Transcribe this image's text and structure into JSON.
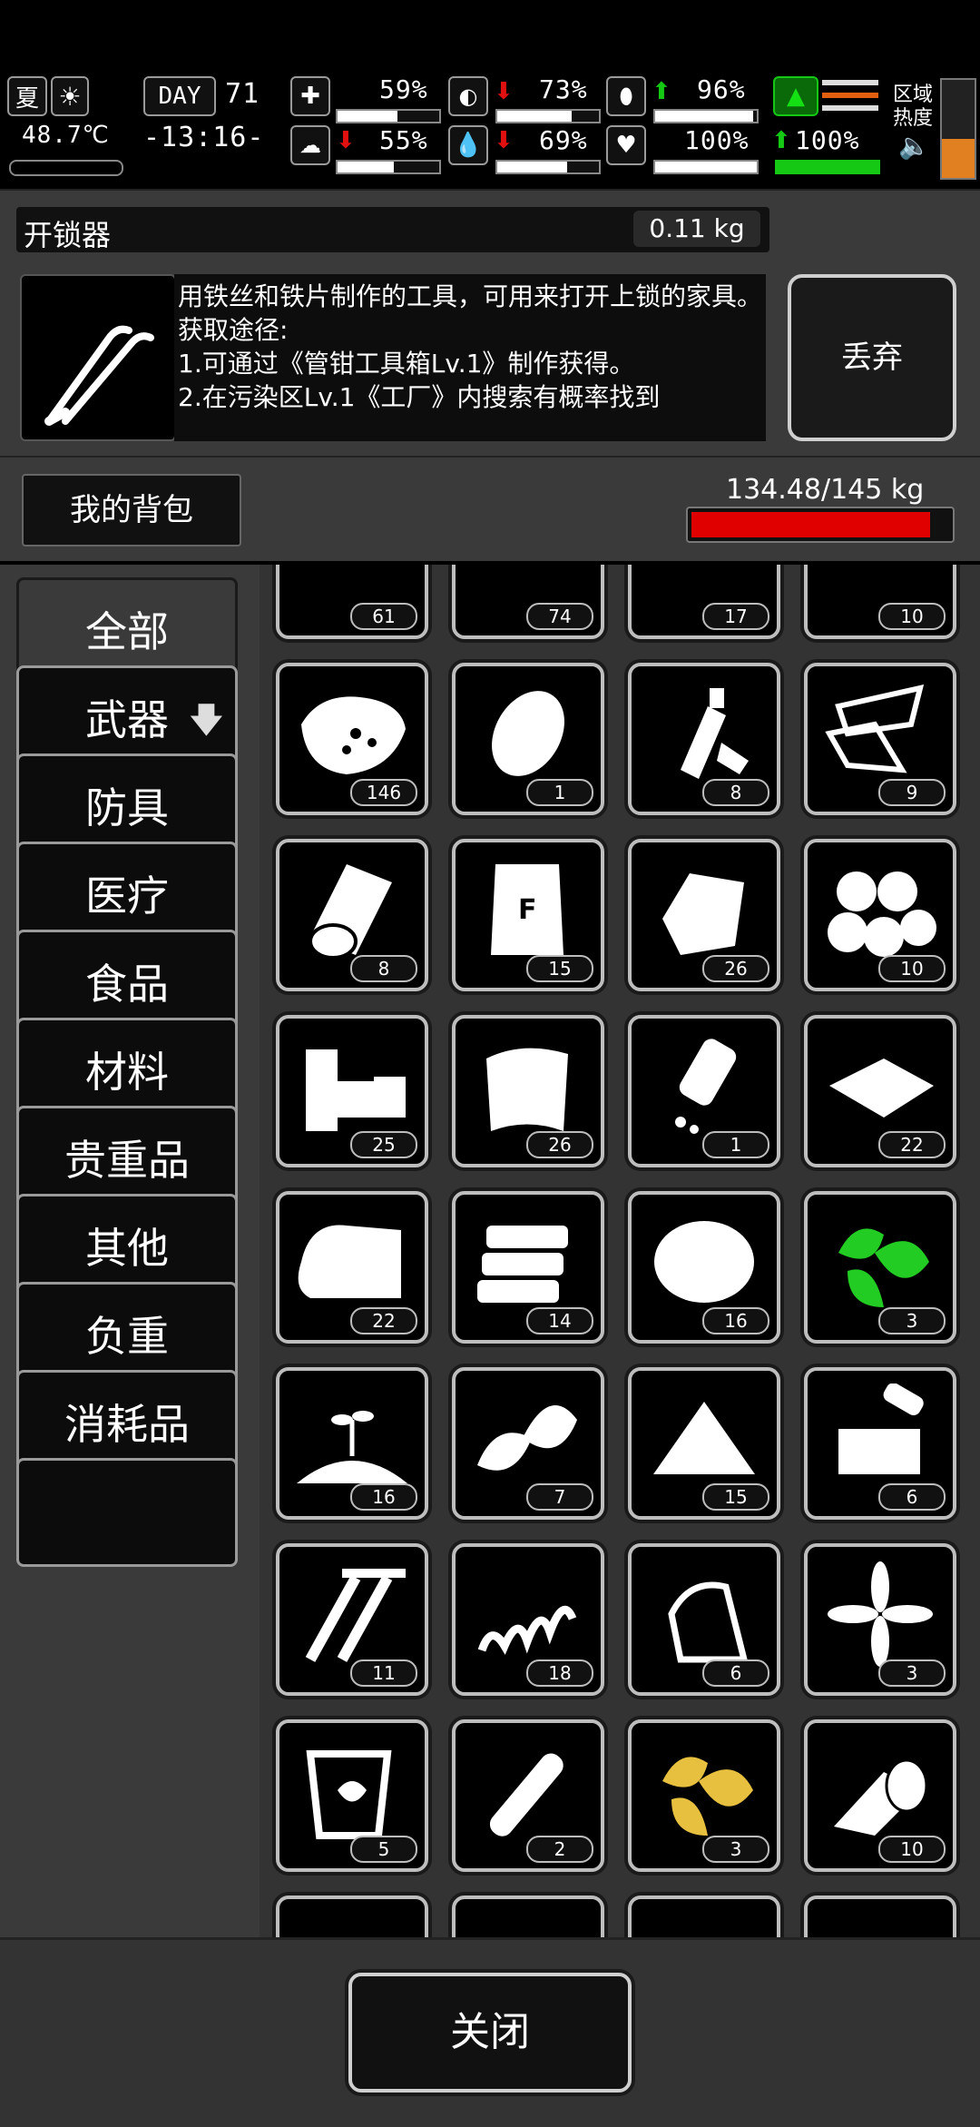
{
  "status": {
    "season": "夏",
    "temperature": "48.7℃",
    "day_label": "DAY",
    "day": "71",
    "time": "-13:16-",
    "area_heat_label": "区域\n热度",
    "stats": [
      {
        "name": "health",
        "icon": "medkit-icon",
        "value": "59%",
        "fill": 0.59,
        "trend": ""
      },
      {
        "name": "mental",
        "icon": "brain-icon",
        "value": "55%",
        "fill": 0.55,
        "trend": "down"
      },
      {
        "name": "hunger",
        "icon": "stomach-icon",
        "value": "73%",
        "fill": 0.73,
        "trend": "down"
      },
      {
        "name": "thirst",
        "icon": "water-drop-icon",
        "value": "69%",
        "fill": 0.69,
        "trend": "down"
      },
      {
        "name": "stamina",
        "icon": "pill-icon",
        "value": "96%",
        "fill": 0.96,
        "trend": "up"
      },
      {
        "name": "heart",
        "icon": "heart-icon",
        "value": "100%",
        "fill": 1.0,
        "trend": ""
      },
      {
        "name": "fatigue",
        "icon": "boot-icon",
        "value": "100%",
        "fill": 1.0,
        "trend": "up"
      }
    ]
  },
  "item_detail": {
    "name": "开锁器",
    "weight": "0.11 kg",
    "description": "用铁丝和铁片制作的工具，可用来打开上锁的家具。\n获取途径:\n1.可通过《管钳工具箱Lv.1》制作获得。\n2.在污染区Lv.1《工厂》内搜索有概率找到",
    "discard_label": "丢弃"
  },
  "backpack": {
    "title": "我的背包",
    "capacity": "134.48/145 kg",
    "load_fraction": 0.927
  },
  "categories": [
    {
      "label": "全部",
      "active": true
    },
    {
      "label": "武器",
      "active": false,
      "download": "🡇"
    },
    {
      "label": "防具",
      "active": false
    },
    {
      "label": "医疗",
      "active": false
    },
    {
      "label": "食品",
      "active": false
    },
    {
      "label": "材料",
      "active": false
    },
    {
      "label": "贵重品",
      "active": false
    },
    {
      "label": "其他",
      "active": false
    },
    {
      "label": "负重",
      "active": false
    },
    {
      "label": "消耗品",
      "active": false
    },
    {
      "label": "",
      "active": false
    }
  ],
  "items": [
    {
      "icon": "cloth-pile-icon",
      "count": "61"
    },
    {
      "icon": "cloth-strips-icon",
      "count": "74"
    },
    {
      "icon": "pipes-icon",
      "count": "17"
    },
    {
      "icon": "yellow-cloth-icon",
      "count": "10"
    },
    {
      "icon": "coal-bag-icon",
      "count": "146"
    },
    {
      "icon": "potato-icon",
      "count": "1"
    },
    {
      "icon": "plastic-bottle-icon",
      "count": "8"
    },
    {
      "icon": "metal-sheet-icon",
      "count": "9"
    },
    {
      "icon": "cloth-roll-icon",
      "count": "8"
    },
    {
      "icon": "flour-bag-icon",
      "count": "15"
    },
    {
      "icon": "scrap-metal-icon",
      "count": "26"
    },
    {
      "icon": "cotton-balls-icon",
      "count": "10"
    },
    {
      "icon": "wood-planks-icon",
      "count": "25"
    },
    {
      "icon": "rag-icon",
      "count": "26"
    },
    {
      "icon": "pill-bottle-icon",
      "count": "1"
    },
    {
      "icon": "glass-shards-icon",
      "count": "22"
    },
    {
      "icon": "towel-icon",
      "count": "22"
    },
    {
      "icon": "bread-slices-icon",
      "count": "14"
    },
    {
      "icon": "fiber-icon",
      "count": "16"
    },
    {
      "icon": "green-herb-icon",
      "count": "3"
    },
    {
      "icon": "soil-sprout-icon",
      "count": "16"
    },
    {
      "icon": "leaves-icon",
      "count": "7"
    },
    {
      "icon": "powder-pile-icon",
      "count": "15"
    },
    {
      "icon": "electronic-parts-icon",
      "count": "6"
    },
    {
      "icon": "screws-icon",
      "count": "11"
    },
    {
      "icon": "spring-icon",
      "count": "18"
    },
    {
      "icon": "iron-icon",
      "count": "6"
    },
    {
      "icon": "flower-icon",
      "count": "3"
    },
    {
      "icon": "herbal-jar-icon",
      "count": "5"
    },
    {
      "icon": "rolled-paper-icon",
      "count": "2"
    },
    {
      "icon": "yellow-herb-icon",
      "count": "3"
    },
    {
      "icon": "bandage-roll-icon",
      "count": "10"
    },
    {
      "icon": "item-icon",
      "count": ""
    },
    {
      "icon": "item-icon",
      "count": ""
    },
    {
      "icon": "item-icon",
      "count": ""
    },
    {
      "icon": "item-icon",
      "count": ""
    }
  ],
  "close_label": "关闭",
  "colors": {
    "panel": "#3a3a3a",
    "accent_red": "#e00000",
    "up": "#14c814",
    "down": "#e01010",
    "herb_green": "#22cc22",
    "herb_yellow": "#e8c040"
  }
}
